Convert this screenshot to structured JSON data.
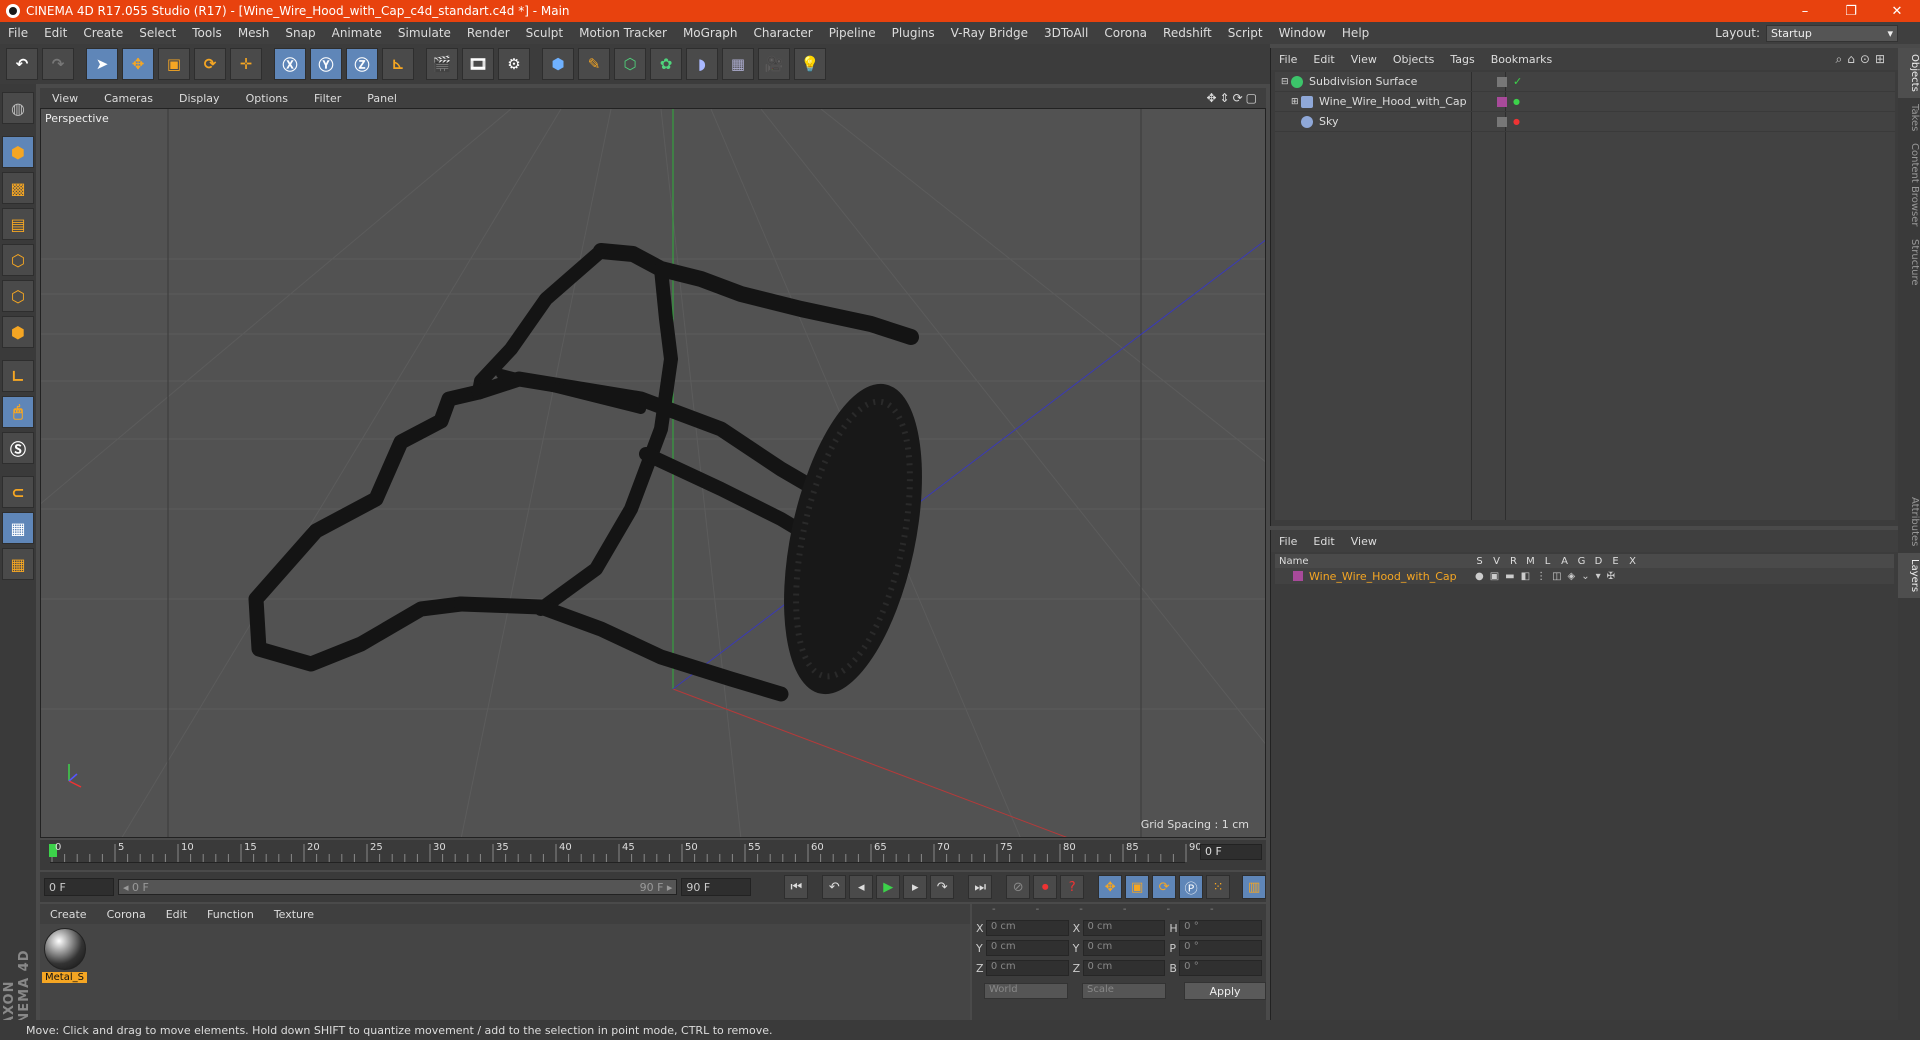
{
  "window": {
    "title": "CINEMA 4D R17.055 Studio (R17) - [Wine_Wire_Hood_with_Cap_c4d_standart.c4d *] - Main",
    "minimize": "–",
    "maximize": "❐",
    "close": "✕"
  },
  "menu": [
    "File",
    "Edit",
    "Create",
    "Select",
    "Tools",
    "Mesh",
    "Snap",
    "Animate",
    "Simulate",
    "Render",
    "Sculpt",
    "Motion Tracker",
    "MoGraph",
    "Character",
    "Pipeline",
    "Plugins",
    "V-Ray Bridge",
    "3DToAll",
    "Corona",
    "Redshift",
    "Script",
    "Window",
    "Help"
  ],
  "layout": {
    "label": "Layout:",
    "value": "Startup"
  },
  "viewport": {
    "menu": [
      "View",
      "Cameras",
      "Display",
      "Options",
      "Filter",
      "Panel"
    ],
    "label": "Perspective",
    "grid_spacing": "Grid Spacing : 1 cm"
  },
  "timeline": {
    "ticks": [
      "0",
      "5",
      "10",
      "15",
      "20",
      "25",
      "30",
      "35",
      "40",
      "45",
      "50",
      "55",
      "60",
      "65",
      "70",
      "75",
      "80",
      "85",
      "90"
    ],
    "current_frame": "0 F"
  },
  "transport": {
    "start": "0 F",
    "slider_left": "◂ 0 F",
    "slider_right": "90 F ▸",
    "end": "90 F"
  },
  "material_manager": {
    "menu": [
      "Create",
      "Corona",
      "Edit",
      "Function",
      "Texture"
    ],
    "material_name": "Metal_S"
  },
  "coordinates": {
    "header": [
      "--",
      "--",
      "--"
    ],
    "rows": [
      {
        "a": "X",
        "av": "0 cm",
        "b": "X",
        "bv": "0 cm",
        "c": "H",
        "cv": "0 °"
      },
      {
        "a": "Y",
        "av": "0 cm",
        "b": "Y",
        "bv": "0 cm",
        "c": "P",
        "cv": "0 °"
      },
      {
        "a": "Z",
        "av": "0 cm",
        "b": "Z",
        "bv": "0 cm",
        "c": "B",
        "cv": "0 °"
      }
    ],
    "world": "World",
    "scale": "Scale",
    "apply": "Apply"
  },
  "object_manager": {
    "menu": [
      "File",
      "Edit",
      "View",
      "Objects",
      "Tags",
      "Bookmarks"
    ],
    "objects": [
      {
        "name": "Subdivision Surface",
        "icon_color": "#3cc46a"
      },
      {
        "name": "Wine_Wire_Hood_with_Cap",
        "icon_color": "#8fa8d8"
      },
      {
        "name": "Sky",
        "icon_color": "#8fa8d8"
      }
    ]
  },
  "layer_manager": {
    "menu": [
      "File",
      "Edit",
      "View"
    ],
    "columns": [
      "Name",
      "S",
      "V",
      "R",
      "M",
      "L",
      "A",
      "G",
      "D",
      "E",
      "X"
    ],
    "layer": "Wine_Wire_Hood_with_Cap"
  },
  "side_tabs": [
    "Objects",
    "Takes",
    "Content Browser",
    "Structure",
    "Attributes",
    "Layers"
  ],
  "status": "Move: Click and drag to move elements. Hold down SHIFT to quantize movement / add to the selection in point mode, CTRL to remove.",
  "colors": {
    "accent": "#e8420e",
    "highlight": "#f5a623",
    "active_tool": "#5f86b8"
  }
}
